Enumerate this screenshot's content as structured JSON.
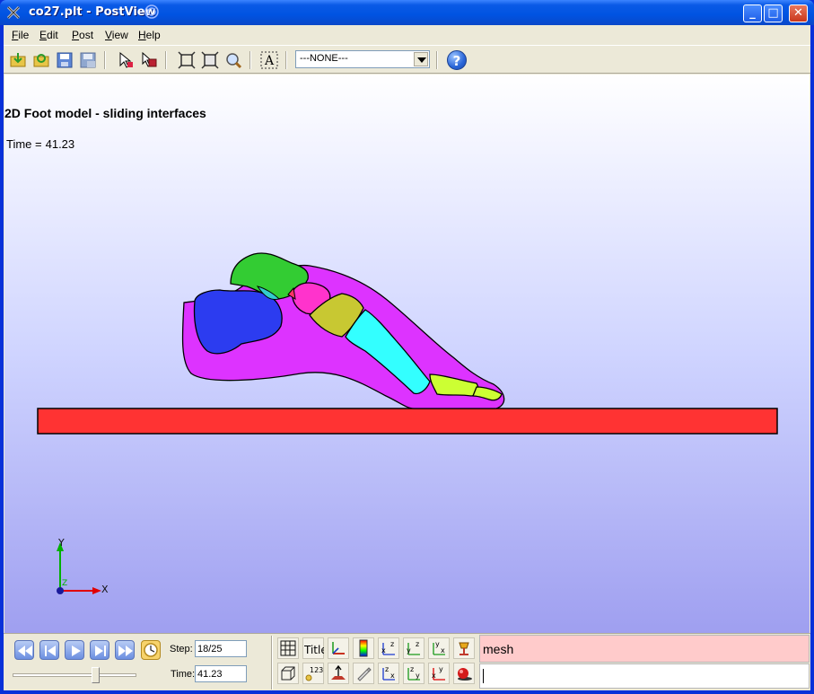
{
  "window": {
    "title": "co27.plt - PostView",
    "minimize_label": "_",
    "maximize_label": "□",
    "close_label": "✕"
  },
  "menu": {
    "items": [
      {
        "label": "File"
      },
      {
        "label": "Edit"
      },
      {
        "label": "Post"
      },
      {
        "label": "View"
      },
      {
        "label": "Help"
      }
    ]
  },
  "toolbar": {
    "icons": [
      "open-folder-icon",
      "reload-icon",
      "save-icon",
      "save-as-icon",
      "select-icon",
      "select-element-icon",
      "zoom-extents-icon",
      "zoom-select-icon",
      "zoom-icon",
      "text-tool-icon"
    ],
    "combo_value": "---NONE---",
    "help_label": "?"
  },
  "viewport": {
    "title": "2D Foot model - sliding interfaces",
    "time_label": "Time =",
    "time_value": "41.23",
    "axes": {
      "y": "Y",
      "x": "X",
      "z": "Z"
    },
    "colors": {
      "ground": "#ff3333",
      "foot_outer": "#dd33ff",
      "calcaneus": "#2c3cf0",
      "talus": "#33cc33",
      "navicular": "#ff33cc",
      "cuneiform": "#c8c832",
      "metatarsal": "#33ffff",
      "phalanx": "#ccff33",
      "joint": "#33cccc"
    }
  },
  "playback": {
    "buttons": [
      "rewind-icon",
      "step-back-icon",
      "play-icon",
      "step-forward-icon",
      "fast-forward-icon",
      "time-settings-icon"
    ],
    "step_label": "Step:",
    "step_value": "18/25",
    "time_label": "Time:",
    "time_value": "41.23",
    "slider_position": 0.68
  },
  "view_buttons": {
    "row1": [
      "mesh-icon",
      "title-icon",
      "axes-icon",
      "color-bar-icon",
      "view-xz-icon",
      "view-yz-icon",
      "view-yx-icon",
      "light-icon"
    ],
    "row2": [
      "box-icon",
      "labels-icon",
      "normal-icon",
      "edit-icon",
      "view-zx-icon",
      "view-zy-icon",
      "view-xy-icon",
      "render-icon"
    ],
    "title_label": "Title",
    "labels_label": "123"
  },
  "status": {
    "mesh_text": "mesh",
    "command_text": ""
  }
}
